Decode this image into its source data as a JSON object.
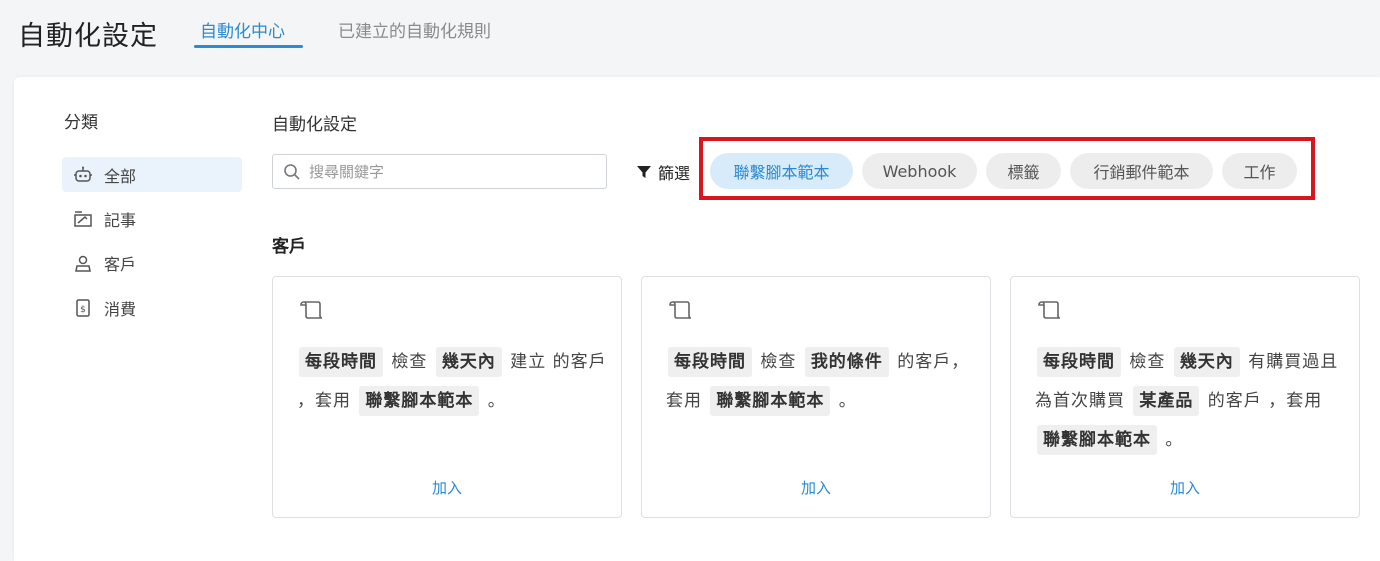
{
  "header": {
    "title": "自動化設定",
    "tabs": [
      {
        "label": "自動化中心",
        "active": true
      },
      {
        "label": "已建立的自動化規則",
        "active": false
      }
    ]
  },
  "sidebar": {
    "title": "分類",
    "items": [
      {
        "label": "全部",
        "icon": "robot-icon",
        "active": true
      },
      {
        "label": "記事",
        "icon": "note-icon",
        "active": false
      },
      {
        "label": "客戶",
        "icon": "customer-icon",
        "active": false
      },
      {
        "label": "消費",
        "icon": "receipt-icon",
        "active": false
      }
    ]
  },
  "main": {
    "title": "自動化設定",
    "search": {
      "placeholder": "搜尋關鍵字",
      "value": ""
    },
    "filter_label": "篩選",
    "chips": [
      {
        "label": "聯繫腳本範本",
        "active": true
      },
      {
        "label": "Webhook",
        "active": false
      },
      {
        "label": "標籤",
        "active": false
      },
      {
        "label": "行銷郵件範本",
        "active": false
      },
      {
        "label": "工作",
        "active": false
      }
    ],
    "section_title": "客戶",
    "cards": [
      {
        "segments": [
          {
            "tag": "每段時間"
          },
          {
            "text": " 檢查 "
          },
          {
            "tag": "幾天內"
          },
          {
            "text": " 建立 的客戶 ，套用 "
          },
          {
            "tag": "聯繫腳本範本"
          },
          {
            "text": " 。"
          }
        ],
        "add_label": "加入"
      },
      {
        "segments": [
          {
            "tag": "每段時間"
          },
          {
            "text": " 檢查 "
          },
          {
            "tag": "我的條件"
          },
          {
            "text": " 的客戶，套用 "
          },
          {
            "tag": "聯繫腳本範本"
          },
          {
            "text": " 。"
          }
        ],
        "add_label": "加入"
      },
      {
        "segments": [
          {
            "tag": "每段時間"
          },
          {
            "text": " 檢查 "
          },
          {
            "tag": "幾天內"
          },
          {
            "text": " 有購買過且為首次購買 "
          },
          {
            "tag": "某產品"
          },
          {
            "text": " 的客戶 ，套用 "
          },
          {
            "tag": "聯繫腳本範本"
          },
          {
            "text": " 。"
          }
        ],
        "add_label": "加入"
      }
    ]
  },
  "colors": {
    "accent": "#2a8ad3",
    "highlight_box": "#d9161d",
    "chip_bg": "#ededed",
    "chip_active_bg": "#d8ebfa"
  }
}
